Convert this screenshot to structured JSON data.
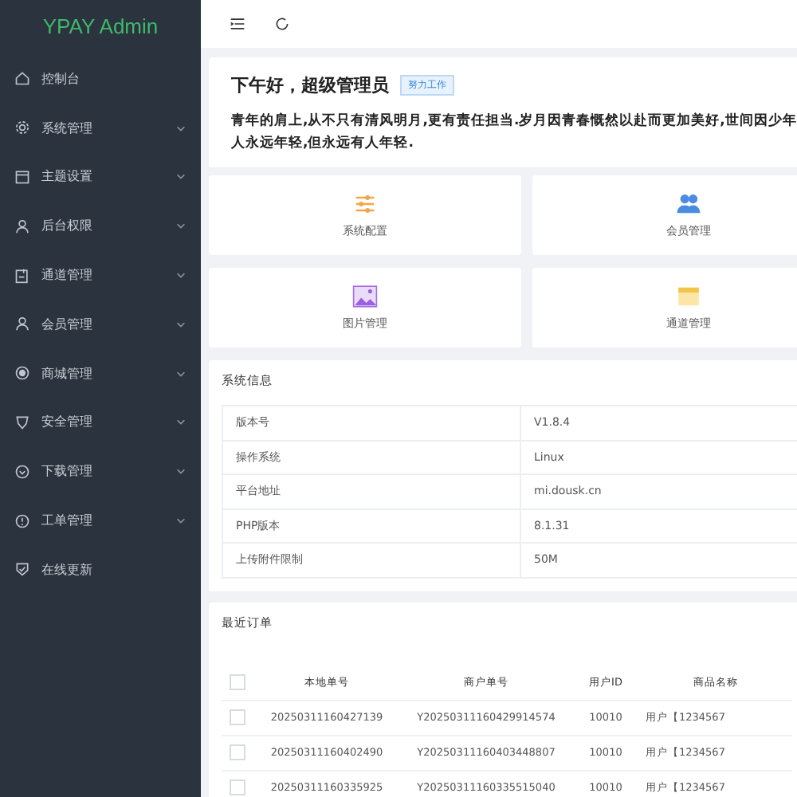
{
  "logo": "YPAY Admin",
  "menu": [
    {
      "label": "控制台",
      "expandable": false
    },
    {
      "label": "系统管理",
      "expandable": true
    },
    {
      "label": "主题设置",
      "expandable": true
    },
    {
      "label": "后台权限",
      "expandable": true
    },
    {
      "label": "通道管理",
      "expandable": true
    },
    {
      "label": "会员管理",
      "expandable": true
    },
    {
      "label": "商城管理",
      "expandable": true
    },
    {
      "label": "安全管理",
      "expandable": true
    },
    {
      "label": "下载管理",
      "expandable": true
    },
    {
      "label": "工单管理",
      "expandable": true
    },
    {
      "label": "在线更新",
      "expandable": false
    }
  ],
  "welcome": {
    "greeting": "下午好，超级管理员",
    "tag": "努力工作",
    "lines": [
      "青年的肩上,从不只有清风明月,更有责任担当.岁月因青春慨然以赴而更加美好,世间因少年",
      "人永远年轻,但永远有人年轻."
    ]
  },
  "shortcuts": [
    {
      "label": "系统配置"
    },
    {
      "label": "会员管理"
    },
    {
      "label": "图片管理"
    },
    {
      "label": "通道管理"
    }
  ],
  "system_info": {
    "title": "系统信息",
    "rows": [
      {
        "name": "版本号",
        "value": "V1.8.4"
      },
      {
        "name": "操作系统",
        "value": "Linux"
      },
      {
        "name": "平台地址",
        "value": "mi.dousk.cn"
      },
      {
        "name": "PHP版本",
        "value": "8.1.31"
      },
      {
        "name": "上传附件限制",
        "value": "50M"
      }
    ]
  },
  "orders": {
    "title": "最近订单",
    "all_checked": false,
    "columns": [
      "本地单号",
      "商户单号",
      "用户ID",
      "商品名称"
    ],
    "rows": [
      {
        "checked": false,
        "cells": [
          "20250311160427139",
          "Y20250311160429914574",
          "10010",
          "用户【1234567"
        ]
      },
      {
        "checked": false,
        "cells": [
          "20250311160402490",
          "Y20250311160403448807",
          "10010",
          "用户【1234567"
        ]
      },
      {
        "checked": false,
        "cells": [
          "20250311160335925",
          "Y20250311160335515040",
          "10010",
          "用户【1234567"
        ]
      }
    ]
  }
}
